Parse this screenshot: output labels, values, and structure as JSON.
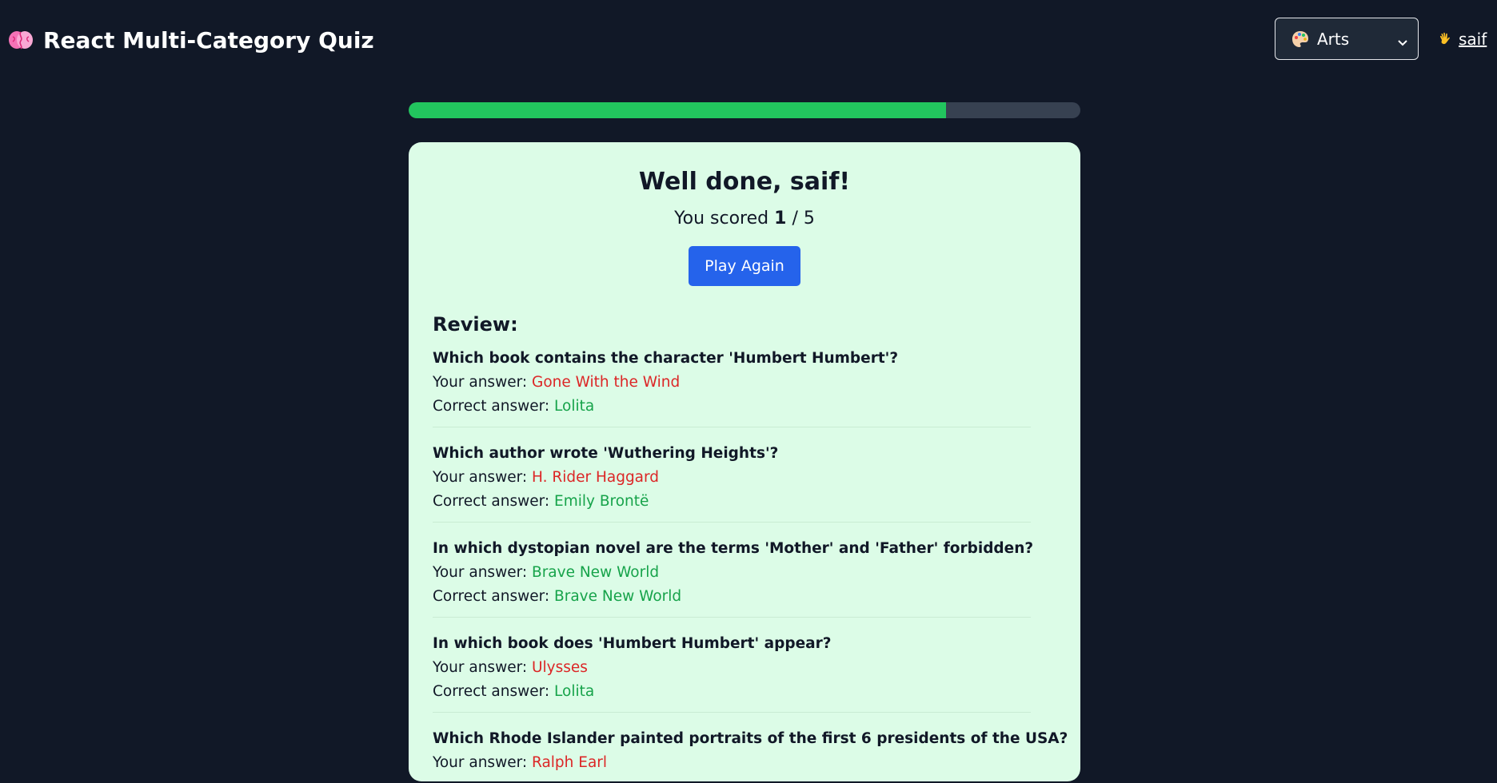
{
  "header": {
    "title": "React Multi-Category Quiz",
    "logo_icon": "brain-icon",
    "category_select": {
      "selected": "Arts",
      "icon": "palette-icon"
    },
    "user": {
      "name": "saif",
      "icon": "waving-hand-icon"
    }
  },
  "progress": {
    "fraction": 0.8
  },
  "result": {
    "title": "Well done, saif!",
    "score_prefix": "You scored",
    "score": "1",
    "score_separator": "/",
    "total": "5",
    "play_again_label": "Play Again"
  },
  "review": {
    "heading": "Review:",
    "your_answer_label": "Your answer:",
    "correct_answer_label": "Correct answer:",
    "items": [
      {
        "question": "Which book contains the character 'Humbert Humbert'?",
        "your_answer": "Gone With the Wind",
        "correct_answer": "Lolita",
        "is_correct": false
      },
      {
        "question": "Which author wrote 'Wuthering Heights'?",
        "your_answer": "H. Rider Haggard",
        "correct_answer": "Emily Brontë",
        "is_correct": false
      },
      {
        "question": "In which dystopian novel are the terms 'Mother' and 'Father' forbidden?",
        "your_answer": "Brave New World",
        "correct_answer": "Brave New World",
        "is_correct": true
      },
      {
        "question": "In which book does 'Humbert Humbert' appear?",
        "your_answer": "Ulysses",
        "correct_answer": "Lolita",
        "is_correct": false
      },
      {
        "question": "Which Rhode Islander painted portraits of the first 6 presidents of the USA?",
        "your_answer": "Ralph Earl",
        "correct_answer": "",
        "is_correct": false
      }
    ]
  },
  "colors": {
    "background": "#111827",
    "card": "#dcfce7",
    "progress": "#22c55e",
    "button": "#2563eb",
    "wrong": "#dc2626",
    "right": "#16a34a"
  }
}
